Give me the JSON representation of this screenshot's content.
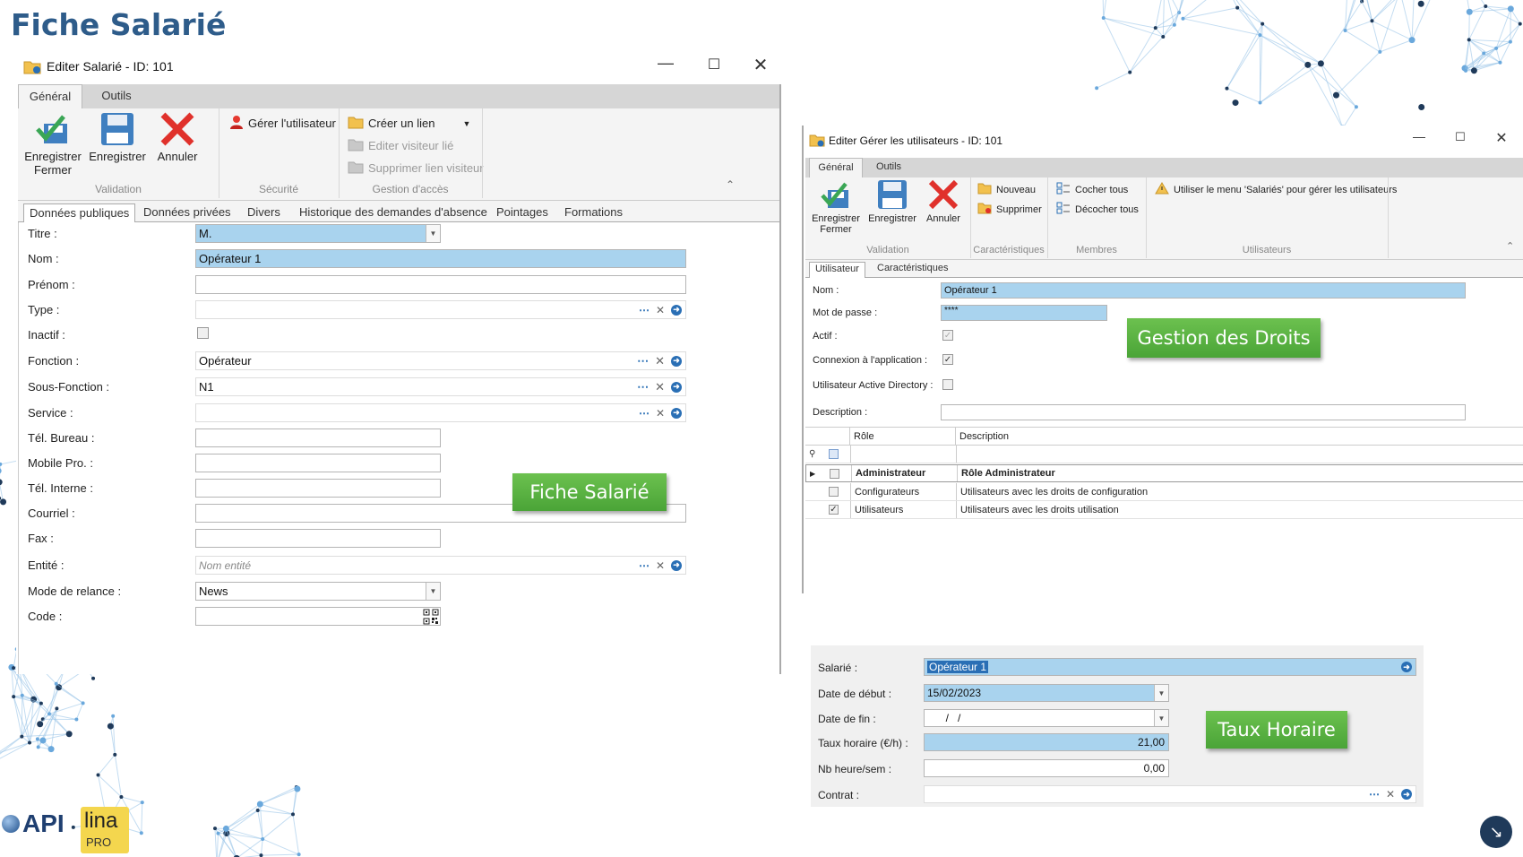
{
  "slide": {
    "title": "Fiche Salarié"
  },
  "win1": {
    "title": "Editer Salarié - ID: 101",
    "tabs": [
      "Général",
      "Outils"
    ],
    "ribbon": {
      "save_close": "Enregistrer\nFermer",
      "save": "Enregistrer",
      "cancel": "Annuler",
      "manage_user": "Gérer l'utilisateur",
      "create_link": "Créer un lien",
      "edit_visitor": "Editer visiteur lié",
      "delete_visitor_link": "Supprimer lien visiteur",
      "groups": [
        "Validation",
        "Sécurité",
        "Gestion d'accès"
      ]
    },
    "subtabs": [
      "Données publiques",
      "Données privées",
      "Divers",
      "Historique des demandes d'absence",
      "Pointages",
      "Formations"
    ],
    "fields": {
      "titre_label": "Titre :",
      "titre_value": "M.",
      "nom_label": "Nom :",
      "nom_value": "Opérateur 1",
      "prenom_label": "Prénom :",
      "type_label": "Type :",
      "inactif_label": "Inactif :",
      "fonction_label": "Fonction :",
      "fonction_value": "Opérateur",
      "sousfonction_label": "Sous-Fonction :",
      "sousfonction_value": "N1",
      "service_label": "Service :",
      "telbureau_label": "Tél. Bureau :",
      "mobile_label": "Mobile Pro. :",
      "telinterne_label": "Tél. Interne :",
      "courriel_label": "Courriel :",
      "fax_label": "Fax :",
      "entite_label": "Entité :",
      "entite_placeholder": "Nom entité",
      "relance_label": "Mode de relance :",
      "relance_value": "News",
      "code_label": "Code :"
    }
  },
  "win2": {
    "title": "Editer Gérer les utilisateurs - ID: 101",
    "tabs": [
      "Général",
      "Outils"
    ],
    "ribbon": {
      "save_close": "Enregistrer\nFermer",
      "save": "Enregistrer",
      "cancel": "Annuler",
      "new": "Nouveau",
      "delete": "Supprimer",
      "check_all": "Cocher tous",
      "uncheck_all": "Décocher tous",
      "warning": "Utiliser le menu 'Salariés' pour gérer les utilisateurs",
      "groups": [
        "Validation",
        "Caractéristiques",
        "Membres",
        "Utilisateurs"
      ]
    },
    "subtabs": [
      "Utilisateur",
      "Caractéristiques"
    ],
    "fields": {
      "nom_label": "Nom :",
      "nom_value": "Opérateur 1",
      "mdp_label": "Mot de passe :",
      "mdp_value": "****",
      "actif_label": "Actif :",
      "connexion_label": "Connexion à l'application :",
      "ad_label": "Utilisateur Active Directory :",
      "desc_label": "Description :"
    },
    "grid": {
      "headers": [
        "Rôle",
        "Description"
      ],
      "rows": [
        {
          "role": "Administrateur",
          "description": "Rôle Administrateur",
          "checked": false
        },
        {
          "role": "Configurateurs",
          "description": "Utilisateurs avec les droits de configuration",
          "checked": false
        },
        {
          "role": "Utilisateurs",
          "description": "Utilisateurs avec les droits utilisation",
          "checked": true
        }
      ]
    }
  },
  "panel3": {
    "salarie_label": "Salarié :",
    "salarie_value": "Opérateur 1",
    "debut_label": "Date de début :",
    "debut_value": "15/02/2023",
    "fin_label": "Date de fin :",
    "fin_value": "  /   /",
    "taux_label": "Taux horaire (€/h) :",
    "taux_value": "21,00",
    "nb_label": "Nb heure/sem :",
    "nb_value": "0,00",
    "contrat_label": "Contrat :"
  },
  "callouts": {
    "fiche": "Fiche Salarié",
    "droits": "Gestion des Droits",
    "taux": "Taux Horaire"
  },
  "logo": {
    "api": "API",
    "lina": "lina",
    "pro": "PRO"
  }
}
